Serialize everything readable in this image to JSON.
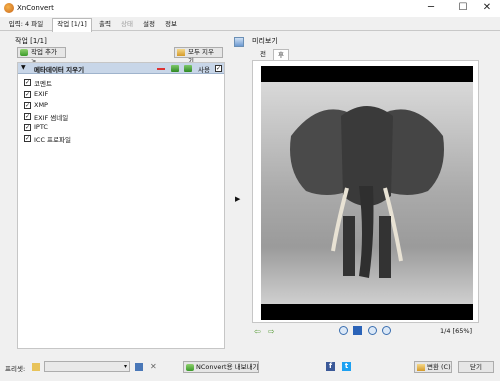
{
  "window": {
    "title": "XnConvert"
  },
  "tabs": [
    {
      "label": "입력: 4 파일"
    },
    {
      "label": "작업 [1/1]"
    },
    {
      "label": "출력"
    },
    {
      "label": "상태"
    },
    {
      "label": "설정"
    },
    {
      "label": "정보"
    }
  ],
  "actions": {
    "label": "작업 [1/1]",
    "add_button": "작업 추가>",
    "clear_button": "모두 지우기",
    "header": {
      "title": "메타데이터 지우기",
      "use_label": "사용",
      "use_checked": "✓"
    },
    "options": [
      {
        "label": "코멘트",
        "checked": "✓"
      },
      {
        "label": "EXIF",
        "checked": "✓"
      },
      {
        "label": "XMP",
        "checked": "✓"
      },
      {
        "label": "EXIF 썸네일",
        "checked": "✓"
      },
      {
        "label": "IPTC",
        "checked": "✓"
      },
      {
        "label": "ICC 프로파일",
        "checked": "✓"
      }
    ]
  },
  "preview": {
    "label": "미리보기",
    "tabs": [
      {
        "label": "전"
      },
      {
        "label": "후"
      }
    ],
    "page_info": "1/4 [65%]"
  },
  "bottom": {
    "preset_label": "프리셋:",
    "preset_value": "",
    "export_button": "NConvert용 내보내기...",
    "convert_button": "변환 (C)",
    "close_button": "닫기"
  },
  "colors": {
    "header_bg": "#c8d6e8",
    "facebook": "#3b5998",
    "twitter": "#1da1f2"
  }
}
